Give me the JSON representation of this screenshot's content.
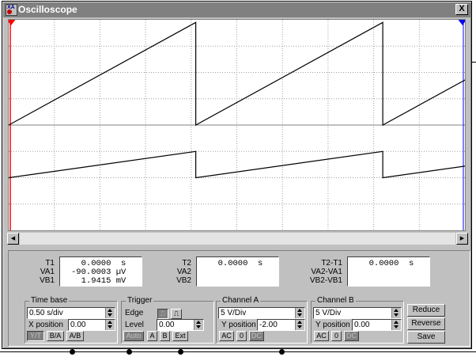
{
  "window": {
    "title": "Oscilloscope",
    "close_label": "X",
    "icon_label": "XA"
  },
  "screen": {
    "background": "#ffffff",
    "grid_color": "#a0a0a0",
    "trace_color": "#000000",
    "cursor_color": "#ff0000",
    "cursor_t1_marker": "T1",
    "cursor_t2_marker": "T2",
    "timebase_s_per_div": 0.5,
    "channel_a_v_per_div": 5,
    "channel_b_v_per_div": 5
  },
  "measurements": {
    "t1": {
      "labels": [
        "T1",
        "VA1",
        "VB1"
      ],
      "values": [
        "  0.0000  s",
        "-90.0003 µV",
        "  1.9415 mV"
      ]
    },
    "t2": {
      "labels": [
        "T2",
        "VA2",
        "VB2"
      ],
      "values": [
        "  0.0000  s",
        "",
        ""
      ]
    },
    "delta": {
      "labels": [
        "T2-T1",
        "VA2-VA1",
        "VB2-VB1"
      ],
      "values": [
        "  0.0000  s",
        "",
        ""
      ]
    }
  },
  "time_base": {
    "title": "Time base",
    "scale": "0.50 s/div",
    "x_position_label": "X position",
    "x_position": "0.00",
    "buttons": [
      "Y/T",
      "B/A",
      "A/B"
    ]
  },
  "trigger": {
    "title": "Trigger",
    "edge_label": "Edge",
    "level_label": "Level",
    "level": "0.00",
    "buttons": [
      "Auto",
      "A",
      "B",
      "Ext"
    ]
  },
  "channel_a": {
    "title": "Channel A",
    "scale": "5 V/Div",
    "y_position_label": "Y position",
    "y_position": "-2.00",
    "buttons": [
      "AC",
      "0",
      "DC"
    ]
  },
  "channel_b": {
    "title": "Channel B",
    "scale": "5 V/Div",
    "y_position_label": "Y position",
    "y_position": "0.00",
    "buttons": [
      "AC",
      "0",
      "DC"
    ]
  },
  "actions": [
    "Reduce",
    "Reverse",
    "Save"
  ],
  "waveforms": {
    "channel_a": {
      "start_div": -2.0,
      "peak_div": 1.9,
      "period_s": 2.05,
      "visible_s": 5.1
    },
    "channel_b": {
      "start_div": 0.0,
      "peak_div": 1.0,
      "period_s": 2.05,
      "visible_s": 5.1
    }
  }
}
